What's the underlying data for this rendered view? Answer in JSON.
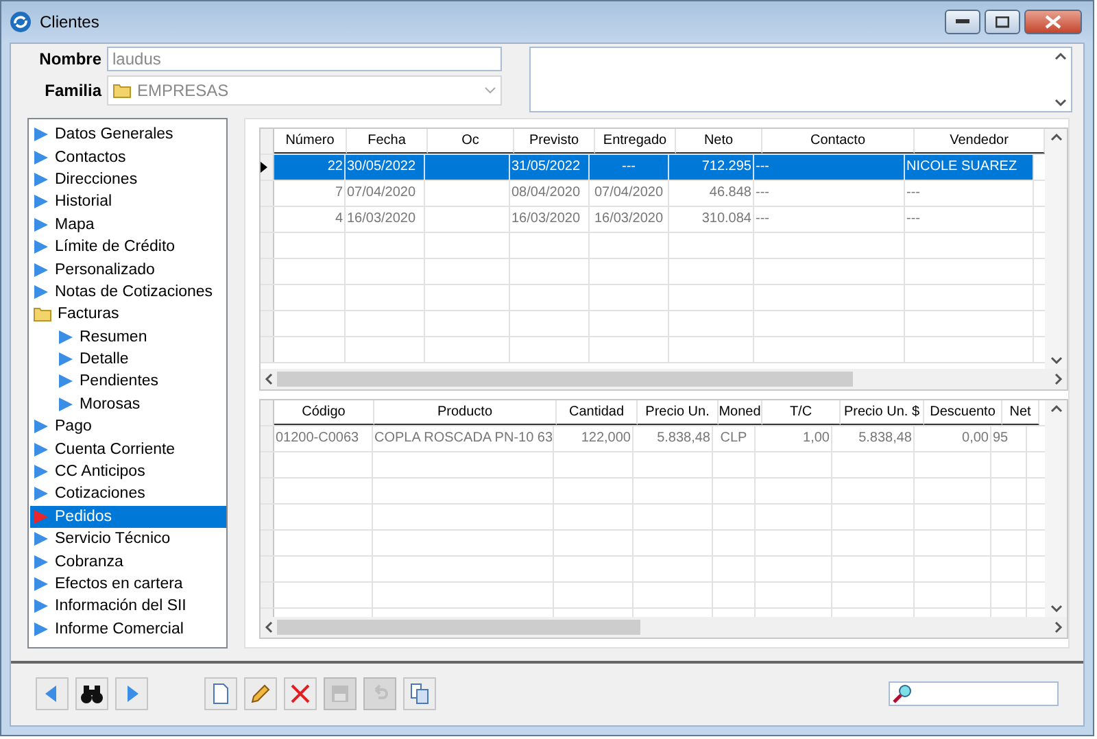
{
  "window": {
    "title": "Clientes"
  },
  "form": {
    "name": {
      "label": "Nombre",
      "value": "laudus"
    },
    "family": {
      "label": "Familia",
      "value": "EMPRESAS"
    }
  },
  "sidebar": {
    "items": [
      {
        "label": "Datos Generales",
        "selected": false
      },
      {
        "label": "Contactos",
        "selected": false
      },
      {
        "label": "Direcciones",
        "selected": false
      },
      {
        "label": "Historial",
        "selected": false
      },
      {
        "label": "Mapa",
        "selected": false
      },
      {
        "label": "Límite de Crédito",
        "selected": false
      },
      {
        "label": "Personalizado",
        "selected": false
      },
      {
        "label": "Notas de Cotizaciones",
        "selected": false
      },
      {
        "label": "Facturas",
        "selected": false,
        "children": [
          {
            "label": "Resumen",
            "selected": false
          },
          {
            "label": "Detalle",
            "selected": false
          },
          {
            "label": "Pendientes",
            "selected": false
          },
          {
            "label": "Morosas",
            "selected": false
          }
        ]
      },
      {
        "label": "Pago",
        "selected": false
      },
      {
        "label": "Cuenta Corriente",
        "selected": false
      },
      {
        "label": "CC Anticipos",
        "selected": false
      },
      {
        "label": "Cotizaciones",
        "selected": false
      },
      {
        "label": "Pedidos",
        "selected": true
      },
      {
        "label": "Servicio Técnico",
        "selected": false
      },
      {
        "label": "Cobranza",
        "selected": false
      },
      {
        "label": "Efectos en cartera",
        "selected": false
      },
      {
        "label": "Información del SII",
        "selected": false
      },
      {
        "label": "Informe Comercial",
        "selected": false
      }
    ]
  },
  "orders": {
    "columns": [
      {
        "label": "Número"
      },
      {
        "label": "Fecha"
      },
      {
        "label": "Oc"
      },
      {
        "label": "Previsto"
      },
      {
        "label": "Entregado"
      },
      {
        "label": "Neto"
      },
      {
        "label": "Contacto"
      },
      {
        "label": "Vendedor"
      }
    ],
    "rows": [
      {
        "selected": true,
        "cells": [
          "22",
          "30/05/2022",
          "",
          "31/05/2022",
          "---",
          "712.295",
          "---",
          "NICOLE SUAREZ"
        ]
      },
      {
        "selected": false,
        "cells": [
          "7",
          "07/04/2020",
          "",
          "08/04/2020",
          "07/04/2020",
          "46.848",
          "---",
          "---"
        ]
      },
      {
        "selected": false,
        "cells": [
          "4",
          "16/03/2020",
          "",
          "16/03/2020",
          "16/03/2020",
          "310.084",
          "---",
          "---"
        ]
      }
    ]
  },
  "lines": {
    "columns": [
      {
        "label": "Código"
      },
      {
        "label": "Producto"
      },
      {
        "label": "Cantidad"
      },
      {
        "label": "Precio Un."
      },
      {
        "label": "Moned"
      },
      {
        "label": "T/C"
      },
      {
        "label": "Precio Un. $"
      },
      {
        "label": "Descuento"
      },
      {
        "label": "Net"
      }
    ],
    "rows": [
      {
        "selected": false,
        "cells": [
          "01200-C0063",
          "COPLA ROSCADA PN-10 63",
          "122,000",
          "5.838,48",
          "CLP",
          "1,00",
          "5.838,48",
          "0,00",
          "95"
        ]
      }
    ]
  },
  "toolbar": {
    "buttons": [
      {
        "kind": "prev",
        "disabled": false
      },
      {
        "kind": "find",
        "disabled": false
      },
      {
        "kind": "next",
        "disabled": false
      },
      {
        "kind": "new",
        "disabled": false
      },
      {
        "kind": "edit",
        "disabled": false
      },
      {
        "kind": "delete",
        "disabled": false
      },
      {
        "kind": "save",
        "disabled": true
      },
      {
        "kind": "undo",
        "disabled": true
      },
      {
        "kind": "copy",
        "disabled": false
      }
    ]
  }
}
